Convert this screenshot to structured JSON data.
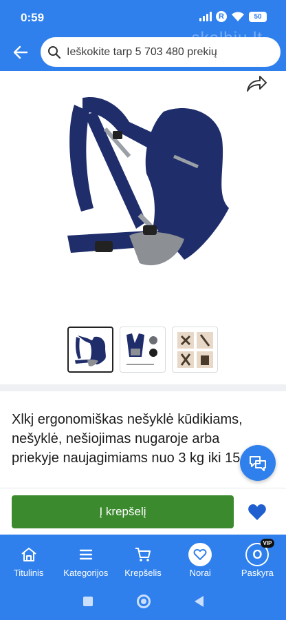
{
  "status": {
    "time": "0:59",
    "battery": "50",
    "r_badge": "R"
  },
  "watermark": "skelbiu.lt",
  "search": {
    "placeholder": "Ieškokite tarp 5 703 480 prekių"
  },
  "product": {
    "title": "Xlkj ergonomiškas nešyklė kūdikiams, nešyklė, nešiojimas nugaroje arba priekyje naujagimiams nuo 3 kg iki 15 kg",
    "image_count": 3,
    "active_thumb": 1
  },
  "actions": {
    "add_to_cart": "Į krepšelį"
  },
  "nav": {
    "items": [
      {
        "label": "Titulinis",
        "icon": "home-icon"
      },
      {
        "label": "Kategorijos",
        "icon": "menu-icon"
      },
      {
        "label": "Krepšelis",
        "icon": "cart-icon"
      },
      {
        "label": "Norai",
        "icon": "heart-icon"
      },
      {
        "label": "Paskyra",
        "icon": "account-icon",
        "badge": "VIP",
        "initial": "O"
      }
    ]
  },
  "colors": {
    "brand_blue": "#2f80ed",
    "cart_green": "#3b8a2e",
    "carrier_navy": "#1f2d6b"
  }
}
